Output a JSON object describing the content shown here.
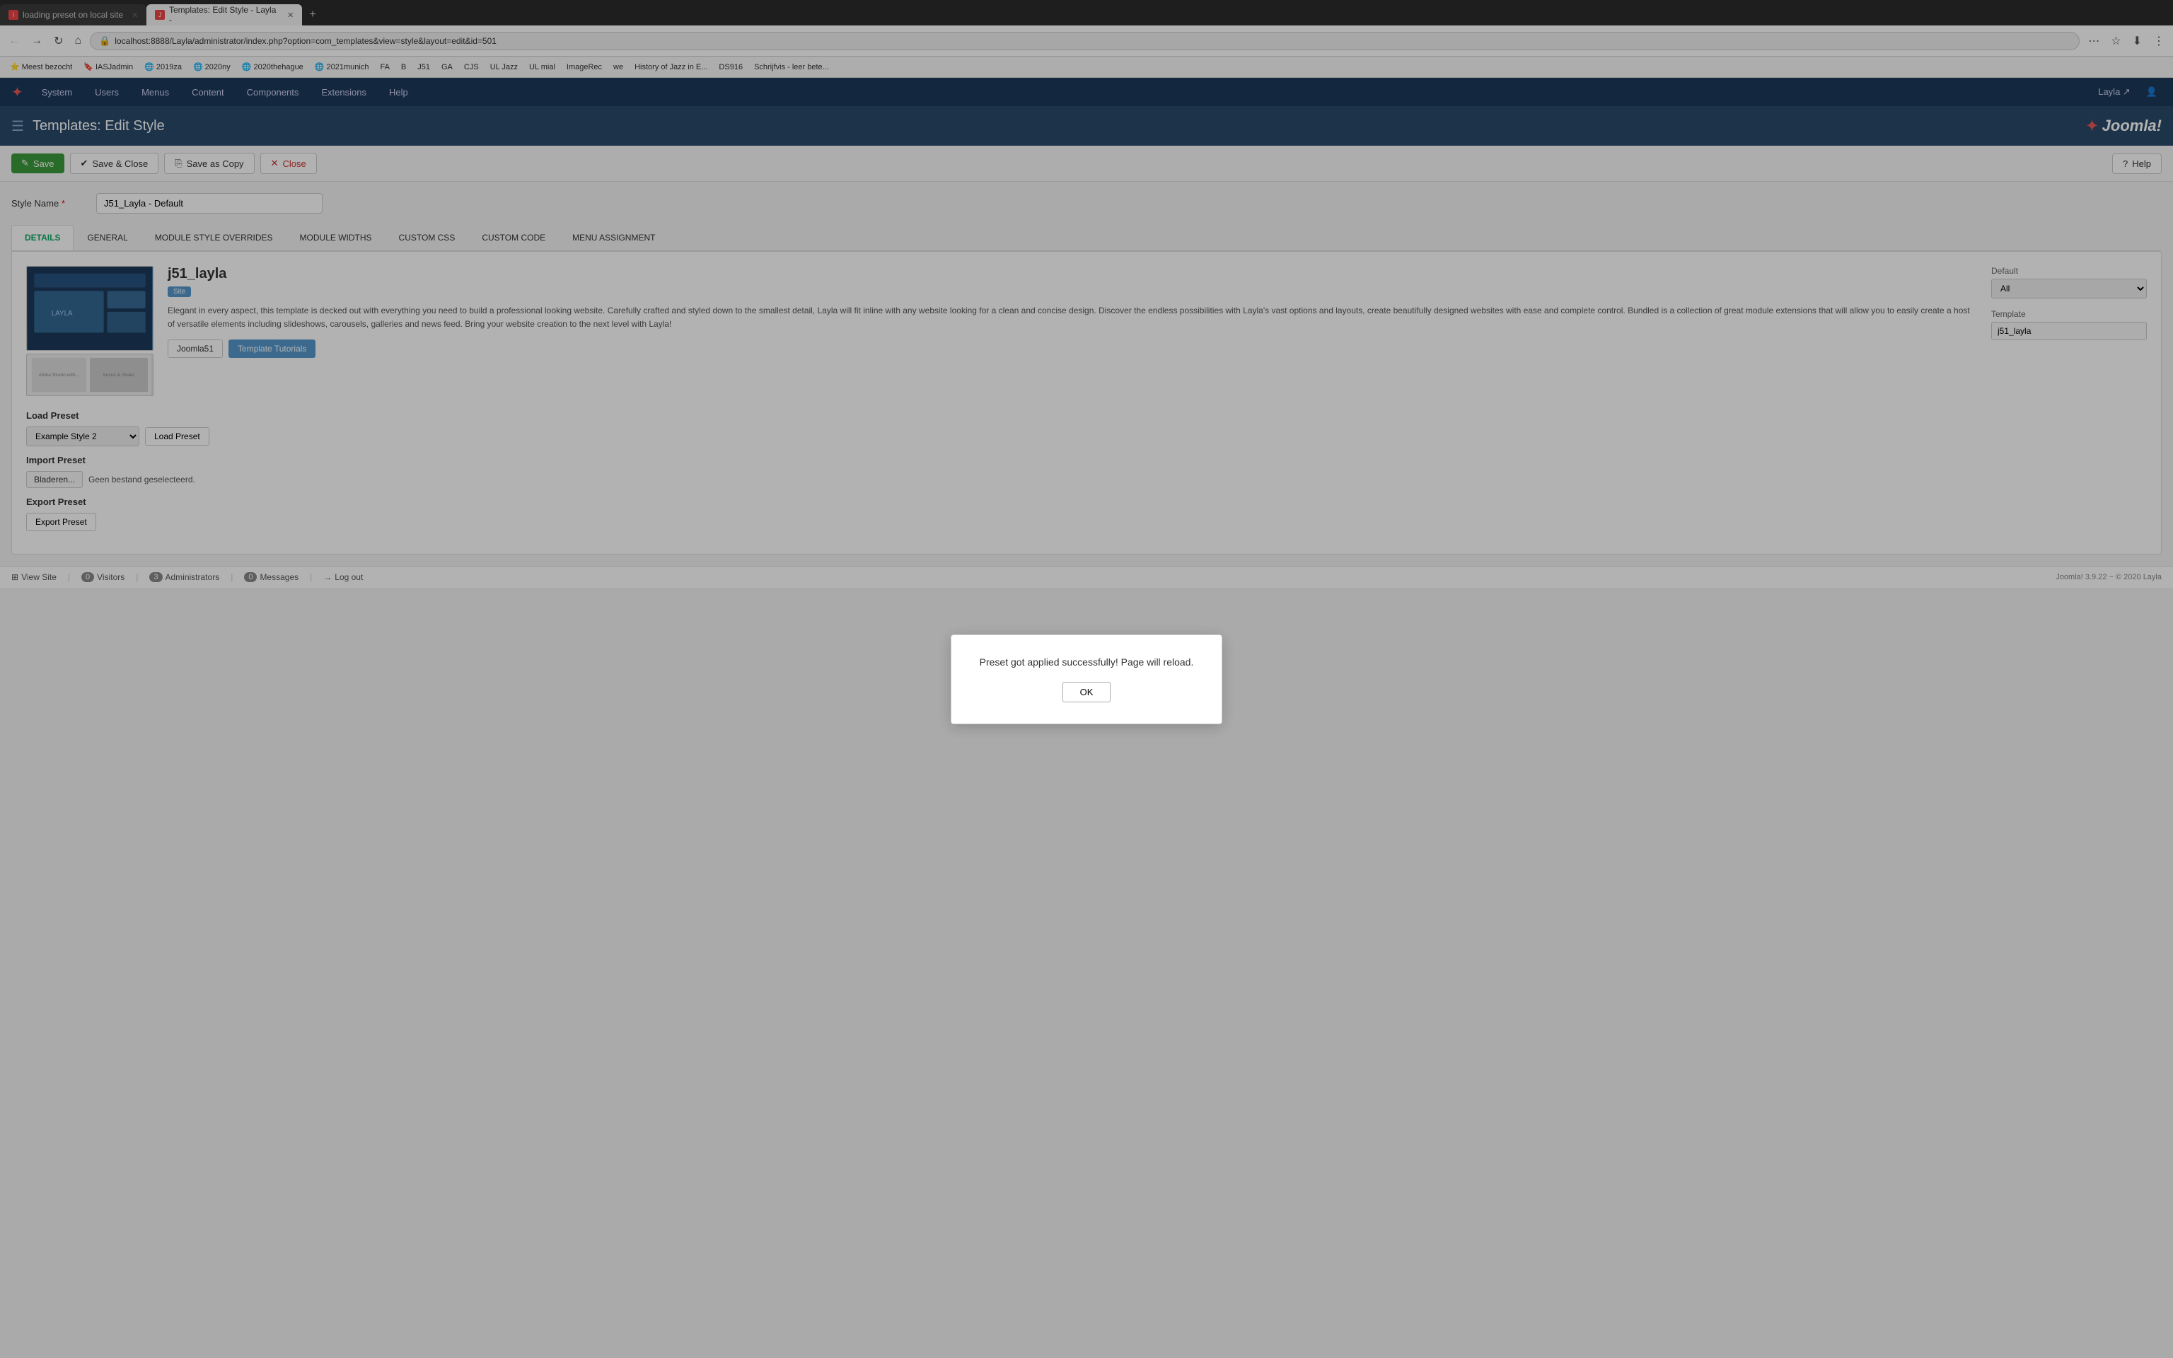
{
  "browser": {
    "tab_active_label": "Templates: Edit Style - Layla -",
    "tab_inactive_label": "loading preset on local site",
    "tab_active_favicon": "J",
    "tab_inactive_favicon": "i",
    "url": "localhost:8888/Layla/administrator/index.php?option=com_templates&view=style&layout=edit&id=501",
    "new_tab_icon": "+"
  },
  "bookmarks": [
    {
      "label": "Meest bezocht"
    },
    {
      "label": "IASJadmin"
    },
    {
      "label": "2019za"
    },
    {
      "label": "2020ny"
    },
    {
      "label": "2020thehague"
    },
    {
      "label": "2021munich"
    },
    {
      "label": "FA"
    },
    {
      "label": "B"
    },
    {
      "label": "J51"
    },
    {
      "label": "GA"
    },
    {
      "label": "CJS"
    },
    {
      "label": "UL Jazz"
    },
    {
      "label": "UL mial"
    },
    {
      "label": "ImageRec"
    },
    {
      "label": "we"
    },
    {
      "label": "History of Jazz in E..."
    },
    {
      "label": "DS916"
    },
    {
      "label": "Schrijfvis - leer bete..."
    }
  ],
  "joomla_nav": {
    "system_icon": "★",
    "items": [
      "System",
      "Users",
      "Menus",
      "Content",
      "Components",
      "Extensions",
      "Help"
    ],
    "user": "Layla ↗",
    "user_icon": "👤"
  },
  "page_header": {
    "icon": "☰",
    "title": "Templates: Edit Style",
    "brand_text": "Joomla!"
  },
  "toolbar": {
    "save_label": "Save",
    "save_close_label": "Save & Close",
    "save_copy_label": "Save as Copy",
    "close_label": "Close",
    "help_label": "Help"
  },
  "form": {
    "style_name_label": "Style Name",
    "style_name_value": "J51_Layla - Default"
  },
  "tabs": {
    "items": [
      "DETAILS",
      "GENERAL",
      "MODULE STYLE OVERRIDES",
      "MODULE WIDTHS",
      "CUSTOM CSS",
      "CUSTOM CODE",
      "MENU ASSIGNMENT"
    ],
    "active": "DETAILS"
  },
  "template_info": {
    "name": "j51_layla",
    "badge": "Site",
    "description": "Elegant in every aspect, this template is decked out with everything you need to build a professional looking website. Carefully crafted and styled down to the smallest detail, Layla will fit inline with any website looking for a clean and concise design. Discover the endless possibilities with Layla's vast options and layouts, create beautifully designed websites with ease and complete control. Bundled is a collection of great module extensions that will allow you to easily create a host of versatile elements including slideshows, carousels, galleries and news feed. Bring your website creation to the next level with Layla!",
    "link1": "Joomla51",
    "link2": "Template Tutorials"
  },
  "right_panel": {
    "default_label": "Default",
    "default_select_value": "All",
    "default_options": [
      "All"
    ],
    "template_label": "Template",
    "template_value": "j51_layla"
  },
  "preset_section": {
    "load_preset_title": "Load Preset",
    "selected_preset": "Example Style 2",
    "preset_options": [
      "Example Style",
      "Example Style 2"
    ],
    "load_btn": "Load Preset",
    "import_title": "Import Preset",
    "browse_btn": "Bladeren...",
    "no_file": "Geen bestand geselecteerd.",
    "export_title": "Export Preset",
    "export_btn": "Export Preset"
  },
  "modal": {
    "message": "Preset got applied successfully! Page will reload.",
    "ok_label": "OK"
  },
  "footer": {
    "view_site": "View Site",
    "visitors_count": "0",
    "visitors_label": "Visitors",
    "admins_count": "3",
    "admins_label": "Administrators",
    "messages_count": "0",
    "messages_label": "Messages",
    "logout_label": "Log out",
    "version": "Joomla! 3.9.22 ~ © 2020 Layla"
  }
}
